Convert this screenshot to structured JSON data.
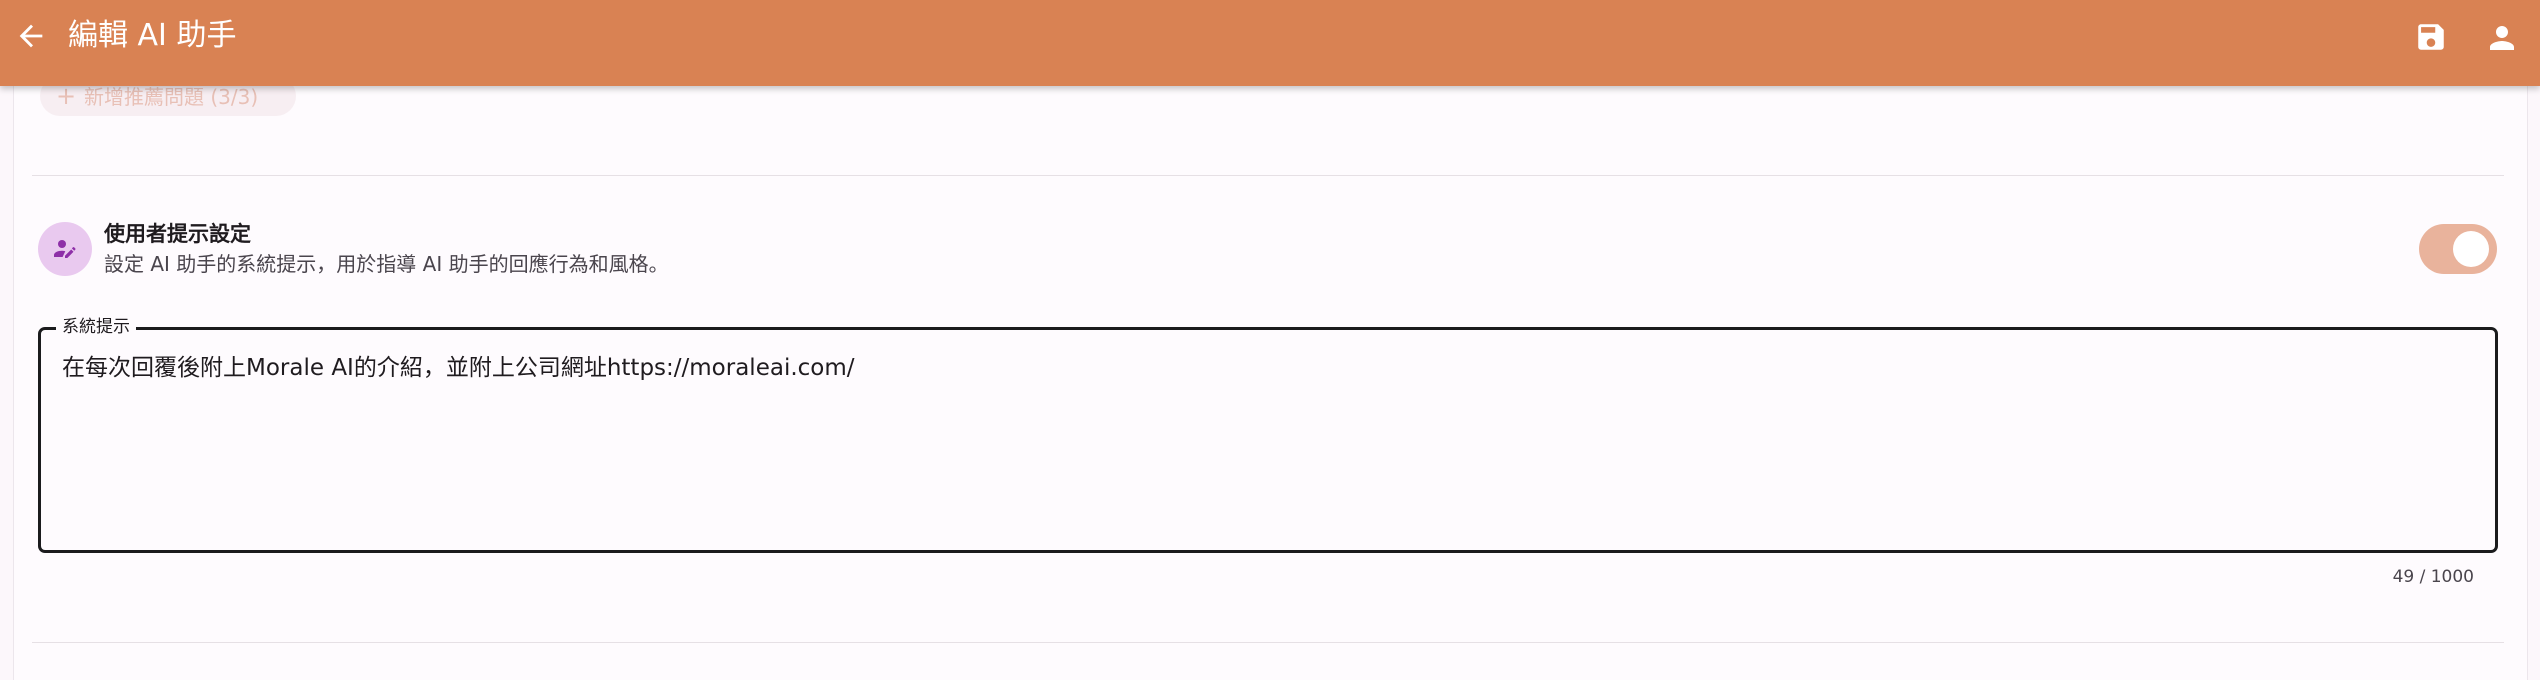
{
  "topbar": {
    "title": "編輯 AI 助手",
    "back_icon": "arrow-back-icon",
    "save_icon": "save-icon",
    "account_icon": "person-icon",
    "color": "#d98253"
  },
  "recommended": {
    "add_button_label": "新增推薦問題 (3/3)",
    "add_icon": "plus-icon"
  },
  "user_prompt_section": {
    "icon": "person-edit-icon",
    "title": "使用者提示設定",
    "description": "設定 AI 助手的系統提示，用於指導 AI 助手的回應行為和風格。",
    "toggle_on": true,
    "toggle_color": "#e9b39c"
  },
  "system_prompt": {
    "label": "系統提示",
    "value": "在每次回覆後附上Morale AI的介紹，並附上公司網址https://moraleai.com/",
    "counter": "49 / 1000"
  }
}
